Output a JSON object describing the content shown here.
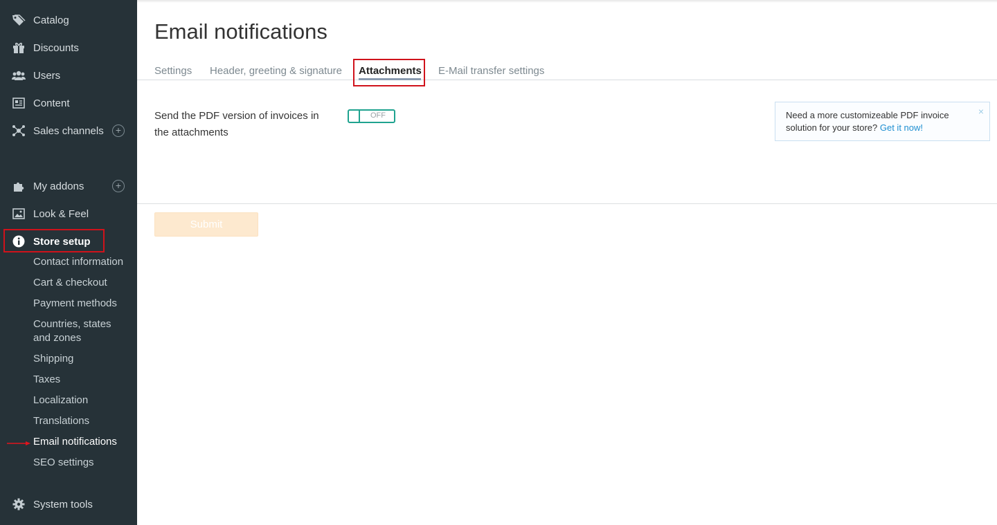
{
  "sidebar": {
    "items": [
      {
        "label": "Catalog",
        "icon": "tag-icon"
      },
      {
        "label": "Discounts",
        "icon": "gift-icon"
      },
      {
        "label": "Users",
        "icon": "users-icon"
      },
      {
        "label": "Content",
        "icon": "newspaper-icon"
      },
      {
        "label": "Sales channels",
        "icon": "network-icon",
        "plus": "+"
      },
      {
        "label": "My addons",
        "icon": "puzzle-icon",
        "plus": "+"
      },
      {
        "label": "Look & Feel",
        "icon": "image-icon"
      },
      {
        "label": "Store setup",
        "icon": "info-icon"
      },
      {
        "label": "System tools",
        "icon": "gear-icon"
      }
    ],
    "store_setup_sub": [
      "Contact information",
      "Cart & checkout",
      "Payment methods",
      "Countries, states and zones",
      "Shipping",
      "Taxes",
      "Localization",
      "Translations",
      "Email notifications",
      "SEO settings"
    ]
  },
  "main": {
    "title": "Email notifications",
    "tabs": [
      "Settings",
      "Header, greeting & signature",
      "Attachments",
      "E-Mail transfer settings"
    ],
    "active_tab": "Attachments",
    "setting": {
      "label": "Send the PDF version of invoices in the attachments",
      "toggle_state": "OFF"
    },
    "promo": {
      "text": "Need a more customizeable PDF invoice solution for your store?",
      "link": "Get it now!",
      "close": "×"
    },
    "submit_label": "Submit"
  },
  "colors": {
    "sidebar_bg": "#263238",
    "toggle_accent": "#1fa38f",
    "link": "#1f8fd1",
    "highlight": "#d0121b",
    "submit_disabled": "#fde9cf"
  }
}
